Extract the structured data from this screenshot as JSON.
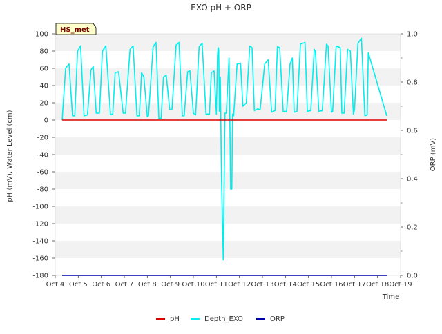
{
  "chart_data": {
    "type": "line",
    "title": "EXO pH + ORP",
    "site_label": "HS_met",
    "xlabel": "Time",
    "ylabel_left": "pH (mV), Water Level (cm)",
    "ylabel_right": "ORP (mV)",
    "x_ticks": [
      "Oct 4",
      "Oct 5",
      "Oct 6",
      "Oct 7",
      "Oct 8",
      "Oct 9",
      "Oct 10",
      "Oct 11",
      "Oct 12",
      "Oct 13",
      "Oct 14",
      "Oct 15",
      "Oct 16",
      "Oct 17",
      "Oct 18",
      "Oct 19"
    ],
    "xlim": [
      4,
      19
    ],
    "ylim_left": [
      -180,
      100
    ],
    "ylim_right": [
      0.0,
      1.0
    ],
    "y_ticks_left": [
      100,
      80,
      60,
      40,
      20,
      0,
      -20,
      -40,
      -60,
      -80,
      -100,
      -120,
      -140,
      -160,
      -180
    ],
    "y_ticks_right": [
      "1.0",
      "0.8",
      "0.6",
      "0.4",
      "0.2",
      "0.0"
    ],
    "y_ticks_right_values": [
      1.0,
      0.8,
      0.6,
      0.4,
      0.2,
      0.0
    ],
    "grid": "horizontal bands",
    "legend_position": "bottom-center",
    "colors": {
      "ph": "#dd0000",
      "depth": "#00eeee",
      "orp": "#0000aa",
      "band": "#f2f2f2",
      "badge_bg": "#ffffcc"
    },
    "series": [
      {
        "name": "pH",
        "axis": "left",
        "x": [
          4.3,
          18.4
        ],
        "y": [
          0,
          0
        ]
      },
      {
        "name": "Depth_EXO",
        "axis": "left",
        "x": [
          4.3,
          4.45,
          4.6,
          4.75,
          4.85,
          4.97,
          5.1,
          5.25,
          5.4,
          5.55,
          5.65,
          5.78,
          5.92,
          6.05,
          6.2,
          6.4,
          6.5,
          6.6,
          6.75,
          6.95,
          7.05,
          7.25,
          7.38,
          7.55,
          7.65,
          7.75,
          7.85,
          8.0,
          8.05,
          8.25,
          8.38,
          8.5,
          8.6,
          8.7,
          8.82,
          8.97,
          9.07,
          9.25,
          9.38,
          9.52,
          9.6,
          9.75,
          9.85,
          10.0,
          10.1,
          10.25,
          10.38,
          10.55,
          10.7,
          10.78,
          10.9,
          11.0,
          11.05,
          11.08,
          11.1,
          11.13,
          11.17,
          11.22,
          11.3,
          11.37,
          11.43,
          11.55,
          11.62,
          11.67,
          11.7,
          11.75,
          11.9,
          12.05,
          12.15,
          12.3,
          12.45,
          12.55,
          12.65,
          12.8,
          12.9,
          13.1,
          13.25,
          13.4,
          13.55,
          13.65,
          13.75,
          13.9,
          14.05,
          14.2,
          14.3,
          14.38,
          14.5,
          14.65,
          14.85,
          14.95,
          15.1,
          15.25,
          15.3,
          15.45,
          15.6,
          15.78,
          15.85,
          16.0,
          16.05,
          16.2,
          16.38,
          16.45,
          16.55,
          16.7,
          16.82,
          16.95,
          17.0,
          17.15,
          17.3,
          17.45,
          17.55,
          17.6,
          18.4
        ],
        "y": [
          0,
          60,
          65,
          5,
          5,
          80,
          86,
          5,
          6,
          58,
          62,
          8,
          8,
          80,
          86,
          6,
          7,
          55,
          56,
          8,
          8,
          82,
          86,
          5,
          5,
          55,
          50,
          4,
          5,
          85,
          90,
          2,
          2,
          50,
          52,
          12,
          12,
          87,
          90,
          5,
          5,
          56,
          57,
          8,
          6,
          85,
          89,
          7,
          7,
          55,
          57,
          7,
          75,
          84,
          82,
          10,
          50,
          -65,
          -162,
          8,
          8,
          72,
          -80,
          -80,
          7,
          5,
          65,
          66,
          16,
          20,
          86,
          84,
          11,
          13,
          12,
          65,
          70,
          9,
          11,
          85,
          84,
          10,
          10,
          65,
          72,
          9,
          10,
          88,
          90,
          10,
          11,
          82,
          80,
          10,
          11,
          88,
          86,
          9,
          10,
          86,
          84,
          8,
          8,
          82,
          80,
          7,
          12,
          89,
          95,
          5,
          6,
          78,
          5
        ]
      },
      {
        "name": "ORP",
        "axis": "left",
        "x": [
          4.3,
          18.4
        ],
        "y": [
          -180,
          -180
        ]
      }
    ]
  }
}
